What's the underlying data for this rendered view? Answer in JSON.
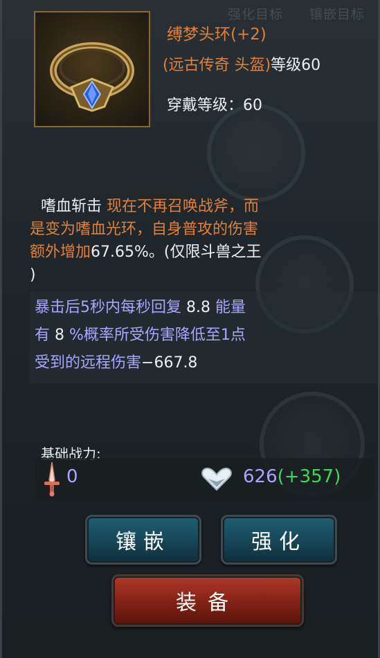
{
  "tabs": [
    "强化目标",
    "镶嵌目标"
  ],
  "item": {
    "name": "缚梦头环(+2)",
    "type": "(远古传奇 头盔)",
    "level_text": "等级60",
    "wear_level_label": "穿戴等级：",
    "wear_level_value": "60",
    "icon": "crown-headband-icon"
  },
  "description": {
    "skill_name": "嗜血斩击 ",
    "line1": "现在不再召唤战斧，而",
    "line2": "是变为嗜血光环，自身普攻的伤害",
    "line3_orange": "额外增加",
    "line3_white": "67.65%。(仅限斗兽之王",
    "line4": ")"
  },
  "stats": [
    {
      "text": "暴击后5秒内每秒回复 ",
      "value": "8.8",
      "suffix": " 能量"
    },
    {
      "text": "有 ",
      "value": "8",
      "suffix": " %概率所受伤害降低至1点"
    },
    {
      "text": "受到的远程伤害",
      "value": "−667.8",
      "suffix": ""
    }
  ],
  "power": {
    "label": "基础战力:",
    "sword_value": "0",
    "value": "626",
    "bonus": "(+357)"
  },
  "buttons": {
    "inlay": "镶嵌",
    "enhance": "强化",
    "equip": "装备"
  },
  "colors": {
    "rarity": "#e0803a",
    "stat": "#a8a6ff",
    "bonus": "#3fd85a"
  }
}
